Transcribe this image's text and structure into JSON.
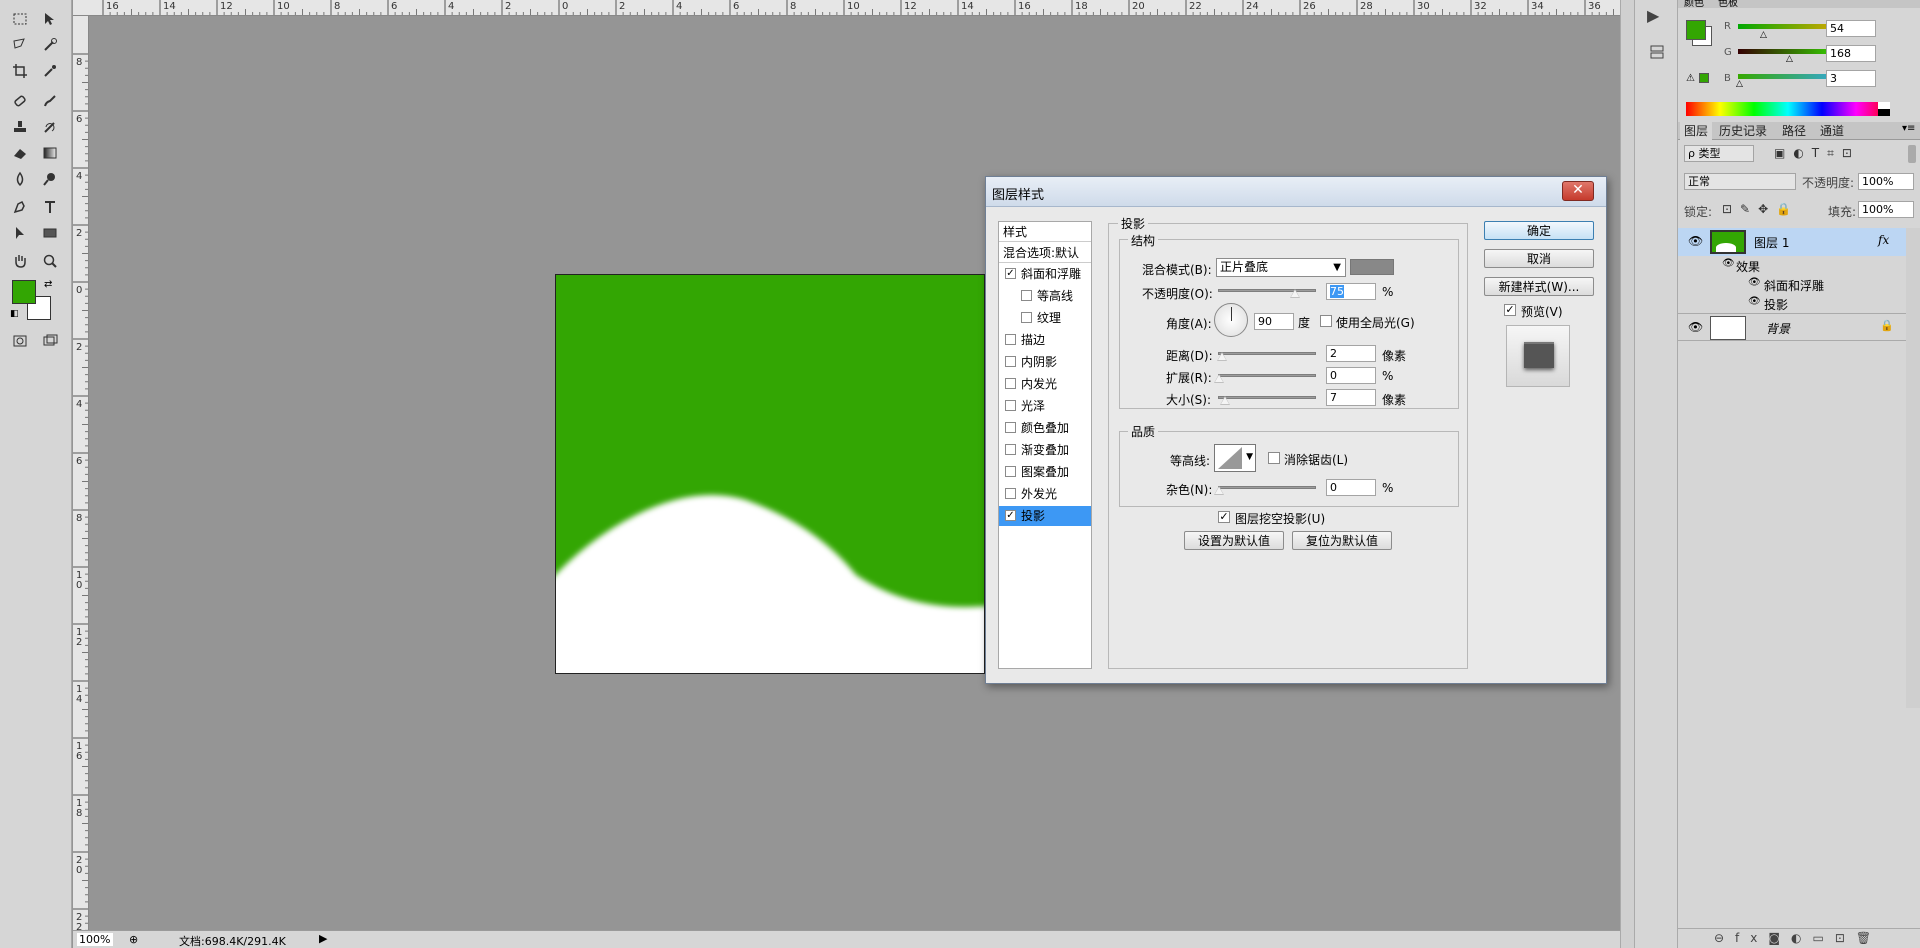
{
  "ruler": {
    "top": [
      "16",
      "14",
      "12",
      "10",
      "8",
      "6",
      "4",
      "2",
      "0",
      "2",
      "4",
      "6",
      "8",
      "10",
      "12",
      "14",
      "16",
      "18",
      "20",
      "22",
      "24",
      "26",
      "28",
      "30",
      "32",
      "34",
      "36"
    ],
    "left": [
      "8",
      "6",
      "4",
      "2",
      "0",
      "2",
      "4",
      "6",
      "8",
      "10",
      "12",
      "14",
      "16",
      "18",
      "20",
      "22"
    ]
  },
  "status": {
    "zoom": "100%",
    "doc": "文档:698.4K/291.4K"
  },
  "colors": {
    "foreground": "#33a603",
    "background": "#ffffff",
    "canvas_green": "#33a603",
    "selected_blue": "#3d98f4"
  },
  "dialog": {
    "title": "图层样式",
    "styles_header": "样式",
    "blend_default": "混合选项:默认",
    "style_items": [
      {
        "label": "斜面和浮雕",
        "checked": true,
        "indent": false,
        "selected": false
      },
      {
        "label": "等高线",
        "checked": false,
        "indent": true,
        "selected": false
      },
      {
        "label": "纹理",
        "checked": false,
        "indent": true,
        "selected": false
      },
      {
        "label": "描边",
        "checked": false,
        "indent": false,
        "selected": false
      },
      {
        "label": "内阴影",
        "checked": false,
        "indent": false,
        "selected": false
      },
      {
        "label": "内发光",
        "checked": false,
        "indent": false,
        "selected": false
      },
      {
        "label": "光泽",
        "checked": false,
        "indent": false,
        "selected": false
      },
      {
        "label": "颜色叠加",
        "checked": false,
        "indent": false,
        "selected": false
      },
      {
        "label": "渐变叠加",
        "checked": false,
        "indent": false,
        "selected": false
      },
      {
        "label": "图案叠加",
        "checked": false,
        "indent": false,
        "selected": false
      },
      {
        "label": "外发光",
        "checked": false,
        "indent": false,
        "selected": false
      },
      {
        "label": "投影",
        "checked": true,
        "indent": false,
        "selected": true
      }
    ],
    "section_title": "投影",
    "structure_title": "结构",
    "blend_mode_label": "混合模式(B):",
    "blend_mode_value": "正片叠底",
    "shadow_color": "#888888",
    "opacity_label": "不透明度(O):",
    "opacity_value": "75",
    "opacity_unit": "%",
    "angle_label": "角度(A):",
    "angle_value": "90",
    "angle_unit": "度",
    "global_light_label": "使用全局光(G)",
    "global_light_checked": false,
    "distance_label": "距离(D):",
    "distance_value": "2",
    "distance_unit": "像素",
    "spread_label": "扩展(R):",
    "spread_value": "0",
    "spread_unit": "%",
    "size_label": "大小(S):",
    "size_value": "7",
    "size_unit": "像素",
    "quality_title": "品质",
    "contour_label": "等高线:",
    "antialias_label": "消除锯齿(L)",
    "noise_label": "杂色(N):",
    "noise_value": "0",
    "noise_unit": "%",
    "knockout_label": "图层挖空投影(U)",
    "knockout_checked": true,
    "set_default": "设置为默认值",
    "reset_default": "复位为默认值",
    "ok": "确定",
    "cancel": "取消",
    "new_style": "新建样式(W)...",
    "preview_label": "预览(V)",
    "preview_checked": true
  },
  "color_panel": {
    "tabs": [
      "颜色",
      "色板"
    ],
    "r_label": "R",
    "r_value": "54",
    "g_label": "G",
    "g_value": "168",
    "b_label": "B",
    "b_value": "3"
  },
  "layers_panel": {
    "tabs": [
      "图层",
      "历史记录",
      "路径",
      "通道"
    ],
    "filter_label": "ρ 类型",
    "blend_mode": "正常",
    "opacity_label": "不透明度:",
    "opacity_value": "100%",
    "lock_label": "锁定:",
    "fill_label": "填充:",
    "fill_value": "100%",
    "layer1_name": "图层 1",
    "fx": "fx",
    "effects_label": "效果",
    "effect1": "斜面和浮雕",
    "effect2": "投影",
    "bg_name": "背景"
  }
}
